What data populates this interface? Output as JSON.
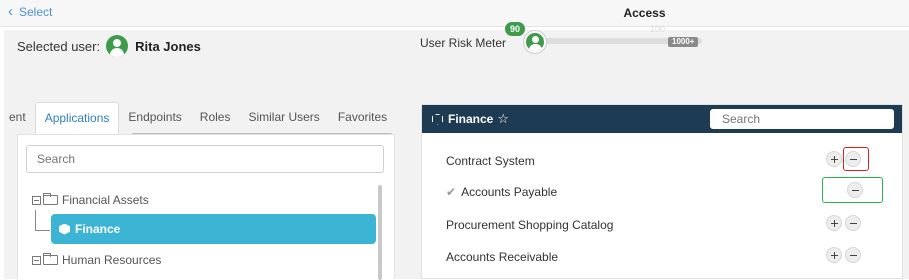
{
  "topbar": {
    "back_label": "Select",
    "title": "Access"
  },
  "user": {
    "prefix": "Selected user:",
    "name": "Rita Jones"
  },
  "risk_meter": {
    "label": "User Risk Meter",
    "value": 90,
    "max_label": "100",
    "badge": "1000+"
  },
  "tabs": [
    {
      "label": "ent",
      "active": false
    },
    {
      "label": "Applications",
      "active": true
    },
    {
      "label": "Endpoints",
      "active": false
    },
    {
      "label": "Roles",
      "active": false
    },
    {
      "label": "Similar Users",
      "active": false
    },
    {
      "label": "Favorites",
      "active": false
    }
  ],
  "left_panel": {
    "search_placeholder": "Search",
    "tree": [
      {
        "label": "Financial Assets"
      },
      {
        "label": "Finance",
        "selected": true
      },
      {
        "label": "Human Resources"
      }
    ]
  },
  "right_panel": {
    "title": "Finance",
    "star": "☆",
    "search_placeholder": "Search",
    "resources": [
      {
        "label": "Contract System",
        "checked": false
      },
      {
        "label": "Accounts Payable",
        "checked": true,
        "check_glyph": "✔"
      },
      {
        "label": "Procurement Shopping Catalog",
        "checked": false
      },
      {
        "label": "Accounts Receivable",
        "checked": false
      }
    ]
  },
  "colors": {
    "accent": "#2f7fc1",
    "header": "#1d3b53",
    "selected_node": "#3cb4d4",
    "risk_green": "#3d9b4a"
  }
}
